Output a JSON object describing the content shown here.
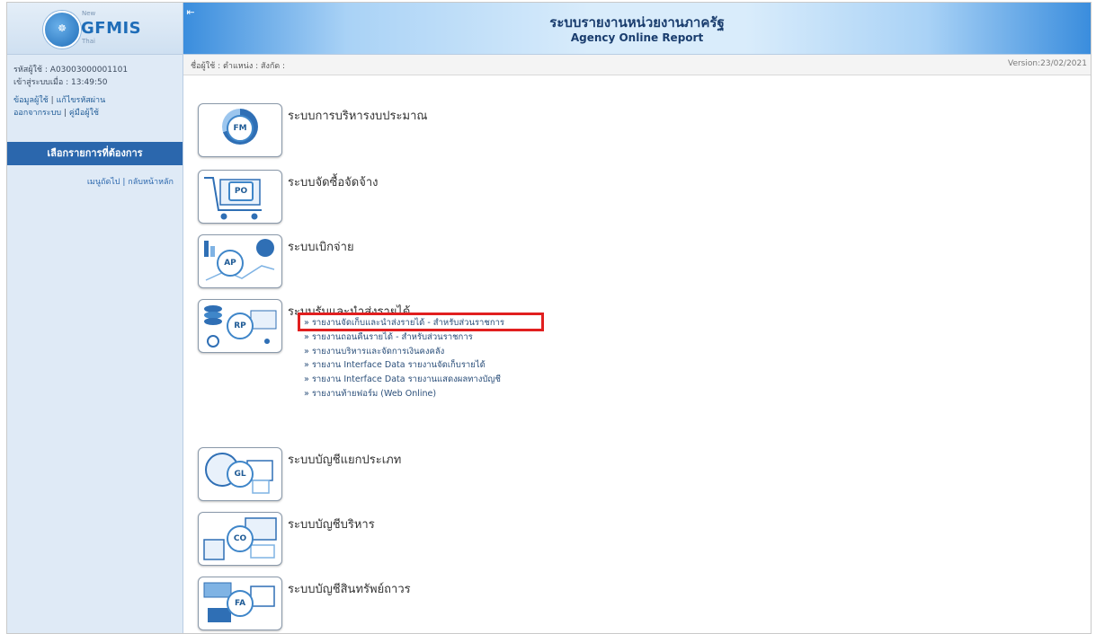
{
  "logo": {
    "new_label": "New",
    "brand": "GFMIS",
    "sub_label": "Thai"
  },
  "sidebar": {
    "user_code": "รหัสผู้ใช้ : A03003000001101",
    "login_time": "เข้าสู่ระบบเมื่อ : 13:49:50",
    "user_info_link": "ข้อมูลผู้ใช้",
    "change_password_link": "แก้ไขรหัสผ่าน",
    "logout_link": "ออกจากระบบ",
    "manual_link": "คู่มือผู้ใช้",
    "menu_header": "เลือกรายการที่ต้องการ",
    "nav_links": "เมนูถัดไป | กลับหน้าหลัก"
  },
  "header": {
    "title": "ระบบรายงานหน่วยงานภาครัฐ",
    "subtitle": "Agency Online Report",
    "infobar_left": "ชื่อผู้ใช้ :  ตำแหน่ง :  สังกัด :",
    "version": "Version:23/02/2021"
  },
  "systems": [
    {
      "code": "FM",
      "title": "ระบบการบริหารงบประมาณ",
      "icon": "fm-budget-icon"
    },
    {
      "code": "PO",
      "title": "ระบบจัดซื้อจัดจ้าง",
      "icon": "po-cart-icon"
    },
    {
      "code": "AP",
      "title": "ระบบเบิกจ่าย",
      "icon": "ap-chart-icon"
    },
    {
      "code": "RP",
      "title": "ระบบรับและนำส่งรายได้",
      "icon": "rp-coins-icon"
    },
    {
      "code": "GL",
      "title": "ระบบบัญชีแยกประเภท",
      "icon": "gl-ledger-icon"
    },
    {
      "code": "CO",
      "title": "ระบบบัญชีบริหาร",
      "icon": "co-monitor-icon"
    },
    {
      "code": "FA",
      "title": "ระบบบัญชีสินทรัพย์ถาวร",
      "icon": "fa-asset-icon"
    }
  ],
  "rp_reports": [
    "» รายงานจัดเก็บและนำส่งรายได้ - สำหรับส่วนราชการ",
    "» รายงานถอนคืนรายได้ - สำหรับส่วนราชการ",
    "» รายงานบริหารและจัดการเงินคงคลัง",
    "» รายงาน Interface Data รายงานจัดเก็บรายได้",
    "» รายงาน Interface Data รายงานแสดงผลทางบัญชี",
    "» รายงานท้ายฟอร์ม (Web Online)"
  ],
  "colors": {
    "accent": "#2b67ad",
    "highlight": "#e11f1f"
  }
}
